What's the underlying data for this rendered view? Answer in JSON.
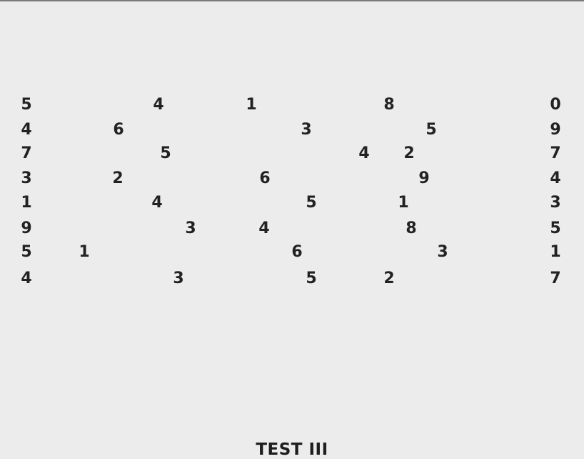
{
  "caption": "TEST III",
  "rows": [
    [
      "5",
      "4",
      "1",
      "8",
      "0"
    ],
    [
      "4",
      "6",
      "3",
      "5",
      "9"
    ],
    [
      "7",
      "5",
      "4",
      "2",
      "7"
    ],
    [
      "3",
      "2",
      "6",
      "9",
      "4"
    ],
    [
      "1",
      "4",
      "5",
      "1",
      "3"
    ],
    [
      "9",
      "3",
      "4",
      "8",
      "5"
    ],
    [
      "5",
      "1",
      "6",
      "3",
      "1"
    ],
    [
      "4",
      "3",
      "5",
      "2",
      "7"
    ]
  ],
  "colors": {
    "background": "#ececec",
    "text": "#222222"
  }
}
